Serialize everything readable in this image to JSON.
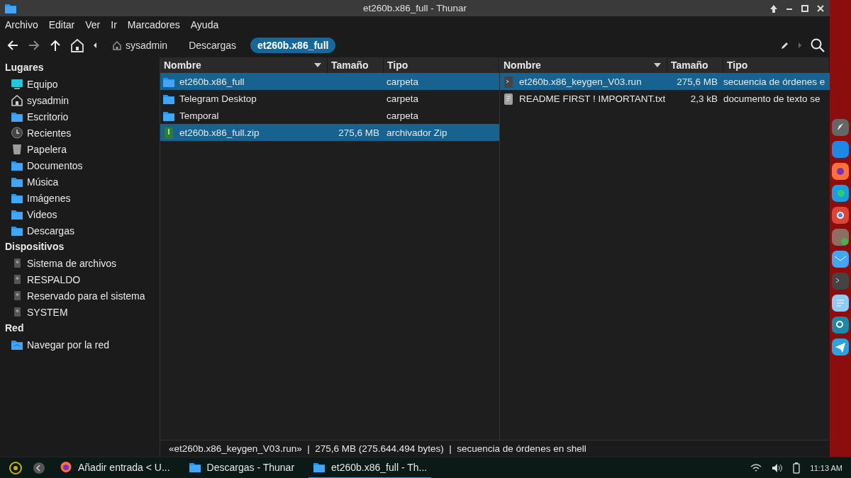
{
  "window": {
    "title": "et260b.x86_full - Thunar"
  },
  "menu": [
    "Archivo",
    "Editar",
    "Ver",
    "Ir",
    "Marcadores",
    "Ayuda"
  ],
  "breadcrumbs": [
    {
      "label": "sysadmin",
      "kind": "home",
      "selected": false
    },
    {
      "label": "Descargas",
      "kind": "folder",
      "selected": false
    },
    {
      "label": "et260b.x86_full",
      "kind": "folder",
      "selected": true
    }
  ],
  "sidebar": [
    {
      "title": "Lugares",
      "items": [
        {
          "label": "Equipo",
          "kind": "computer"
        },
        {
          "label": "sysadmin",
          "kind": "home"
        },
        {
          "label": "Escritorio",
          "kind": "folder"
        },
        {
          "label": "Recientes",
          "kind": "clock"
        },
        {
          "label": "Papelera",
          "kind": "trash"
        },
        {
          "label": "Documentos",
          "kind": "folder"
        },
        {
          "label": "Música",
          "kind": "folder"
        },
        {
          "label": "Imágenes",
          "kind": "folder"
        },
        {
          "label": "Videos",
          "kind": "folder"
        },
        {
          "label": "Descargas",
          "kind": "folder"
        }
      ]
    },
    {
      "title": "Dispositivos",
      "items": [
        {
          "label": "Sistema de archivos",
          "kind": "drive"
        },
        {
          "label": "RESPALDO",
          "kind": "drive"
        },
        {
          "label": "Reservado para el sistema",
          "kind": "drive"
        },
        {
          "label": "SYSTEM",
          "kind": "drive"
        }
      ]
    },
    {
      "title": "Red",
      "items": [
        {
          "label": "Navegar por la red",
          "kind": "network"
        }
      ]
    }
  ],
  "panes": [
    {
      "columns": [
        "Nombre",
        "Tamaño",
        "Tipo"
      ],
      "rows": [
        {
          "name": "et260b.x86_full",
          "size": "",
          "type": "carpeta",
          "kind": "folder",
          "selected": true
        },
        {
          "name": "Telegram Desktop",
          "size": "",
          "type": "carpeta",
          "kind": "folder",
          "selected": false
        },
        {
          "name": "Temporal",
          "size": "",
          "type": "carpeta",
          "kind": "folder",
          "selected": false
        },
        {
          "name": "et260b.x86_full.zip",
          "size": "275,6 MB",
          "type": "archivador Zip",
          "kind": "zip",
          "selected": true
        }
      ]
    },
    {
      "columns": [
        "Nombre",
        "Tamaño",
        "Tipo"
      ],
      "rows": [
        {
          "name": "et260b.x86_keygen_V03.run",
          "size": "275,6 MB",
          "type": "secuencia de órdenes e",
          "kind": "script",
          "selected": true
        },
        {
          "name": "README FIRST ! IMPORTANT.txt",
          "size": "2,3 kB",
          "type": "documento de texto se",
          "kind": "text",
          "selected": false
        }
      ]
    }
  ],
  "status_bar": "«et260b.x86_keygen_V03.run»  |  275,6 MB (275.644.494 bytes)  |  secuencia de órdenes en shell",
  "taskbar": {
    "tasks": [
      {
        "label": "Añadir entrada < U...",
        "kind": "browser",
        "selected": false
      },
      {
        "label": "Descargas - Thunar",
        "kind": "folder",
        "selected": false
      },
      {
        "label": "et260b.x86_full - Th...",
        "kind": "folder",
        "selected": true
      }
    ],
    "clock": "11:13 AM"
  }
}
